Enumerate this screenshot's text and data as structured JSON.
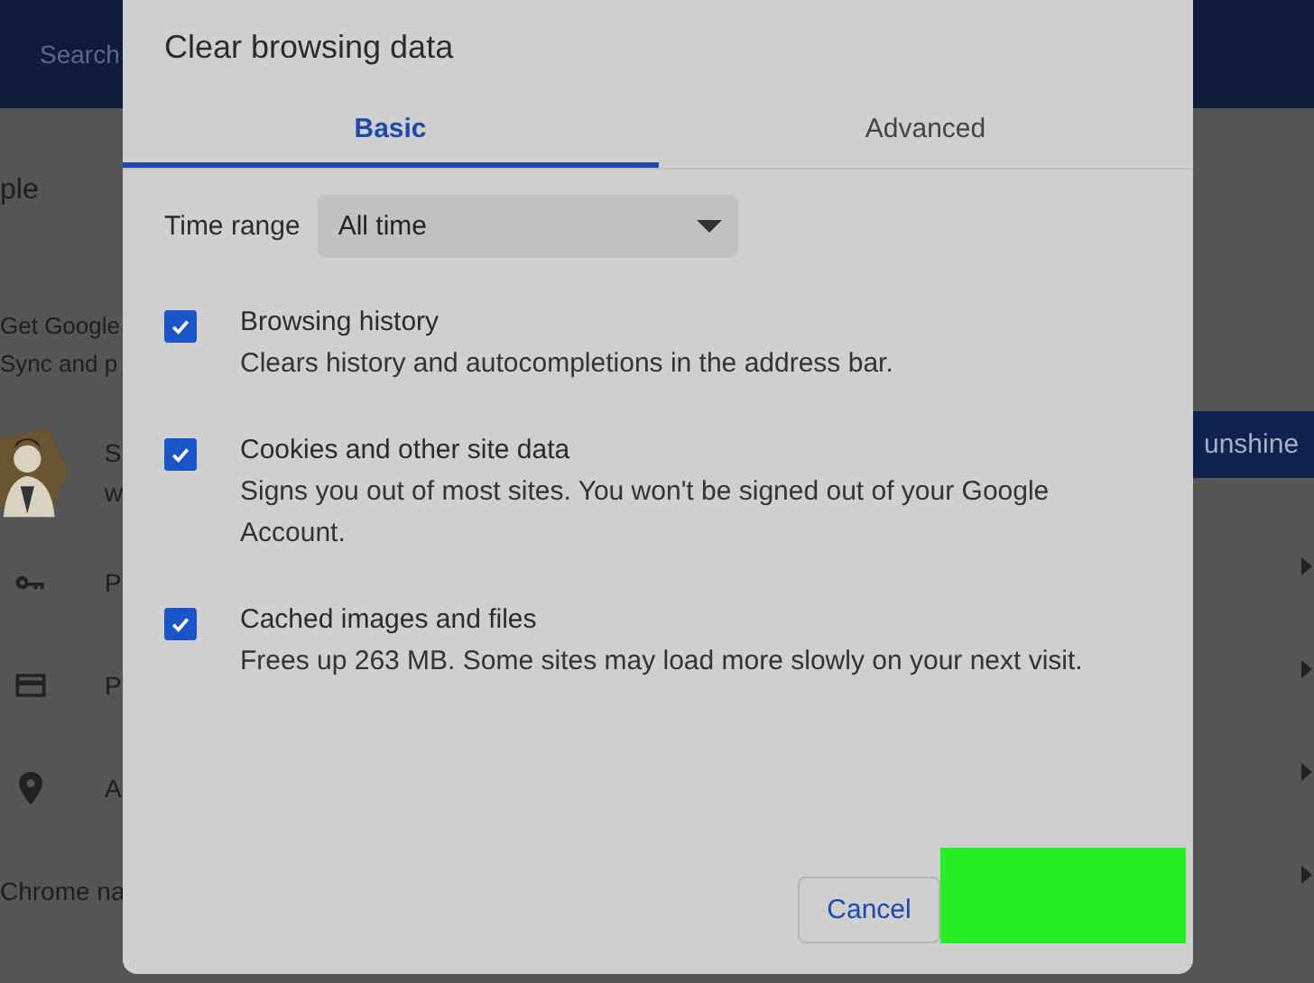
{
  "background": {
    "search": "Search",
    "section_title": "ple",
    "sync_title": "Get Google",
    "sync_description": "Sync and p",
    "profile": {
      "kind": "picture",
      "name": "S",
      "email": "w"
    },
    "items": [
      {
        "kind": "key",
        "label": "P"
      },
      {
        "kind": "card",
        "label": "P"
      },
      {
        "kind": "pin",
        "label": "A"
      }
    ],
    "chrome_name": "Chrome na",
    "banner": "unshine"
  },
  "dialog": {
    "title": "Clear browsing data",
    "tabs": [
      {
        "label": "Basic",
        "selected": true
      },
      {
        "label": "Advanced",
        "selected": false
      }
    ],
    "time_range": {
      "label": "Time range",
      "value": "All time"
    },
    "options": [
      {
        "title": "Browsing history",
        "description": "Clears history and autocompletions in the address bar.",
        "checked": true
      },
      {
        "title": "Cookies and other site data",
        "description": "Signs you out of most sites. You won't be signed out of your Google Account.",
        "checked": true
      },
      {
        "title": "Cached images and files",
        "description": "Frees up 263 MB. Some sites may load more slowly on your next visit.",
        "checked": true
      }
    ],
    "cancel": "Cancel"
  }
}
